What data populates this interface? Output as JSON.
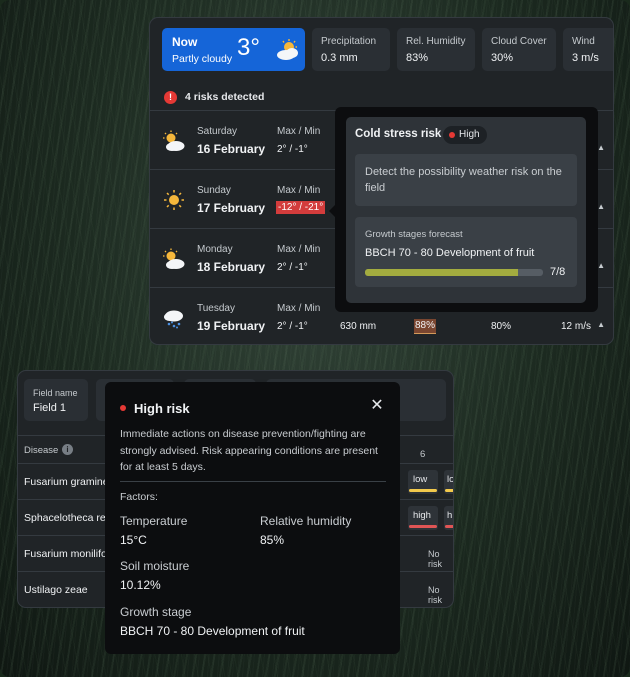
{
  "weather": {
    "now": {
      "label": "Now",
      "condition": "Partly cloudy",
      "temp": "3°",
      "icon": "partly-cloudy-icon"
    },
    "stats": [
      {
        "label": "Precipitation",
        "value": "0.3 mm"
      },
      {
        "label": "Rel. Humidity",
        "value": "83%"
      },
      {
        "label": "Cloud Cover",
        "value": "30%"
      },
      {
        "label": "Wind",
        "value": "3 m/s"
      }
    ],
    "risk_summary": "4 risks detected",
    "days": [
      {
        "day": "Saturday",
        "date": "16 February",
        "maxmin_label": "Max / Min",
        "maxmin": "2° / -1°",
        "icon": "partly-cloudy-icon",
        "highlight": false
      },
      {
        "day": "Sunday",
        "date": "17 February",
        "maxmin_label": "Max / Min",
        "maxmin": "-12° / -21°",
        "icon": "sun-icon",
        "highlight": true
      },
      {
        "day": "Monday",
        "date": "18 February",
        "maxmin_label": "Max / Min",
        "maxmin": "2° / -1°",
        "icon": "partly-cloudy-icon",
        "highlight": false
      },
      {
        "day": "Tuesday",
        "date": "19 February",
        "maxmin_label": "Max / Min",
        "maxmin": "2° / -1°",
        "icon": "rain-icon",
        "highlight": false,
        "precip": "630 mm",
        "humidity": "88%",
        "cloud": "80%",
        "wind": "12 m/s"
      }
    ],
    "arrow": "▲"
  },
  "cold_risk": {
    "title": "Cold stress risk",
    "badge": "High",
    "description": "Detect the possibility weather risk on the field",
    "growth_label": "Growth stages forecast",
    "growth_value": "BBCH 70 - 80 Development of fruit",
    "progress": 0.857,
    "progress_text": "7/8"
  },
  "disease": {
    "field_label": "Field name",
    "field_value": "Field 1",
    "col_label": "Disease",
    "col_6": "6",
    "rows": [
      {
        "name": "Fusarium gramine",
        "cell1": "low",
        "cell2": "lo",
        "status": ""
      },
      {
        "name": "Sphacelotheca rei",
        "cell1": "high",
        "cell2": "h",
        "status": ""
      },
      {
        "name": "Fusarium monilifo",
        "cell1": "",
        "cell2": "",
        "status": "No risk"
      },
      {
        "name": "Ustilago zeae",
        "cell1": "",
        "cell2": "",
        "status": "No risk"
      }
    ]
  },
  "high_risk": {
    "title": "High risk",
    "close": "✕",
    "description": "Immediate actions on disease prevention/fighting are strongly advised. Risk appearing conditions are present for at least 5 days.",
    "factors_label": "Factors:",
    "temperature_label": "Temperature",
    "temperature": "15°C",
    "humidity_label": "Relative humidity",
    "humidity": "85%",
    "soil_label": "Soil moisture",
    "soil": "10.12%",
    "growth_label": "Growth stage",
    "growth": "BBCH 70 - 80 Development of fruit"
  },
  "colors": {
    "accent": "#1565d8",
    "danger": "#e53935",
    "low": "#f2c94c",
    "progress": "#a3ac3f"
  }
}
